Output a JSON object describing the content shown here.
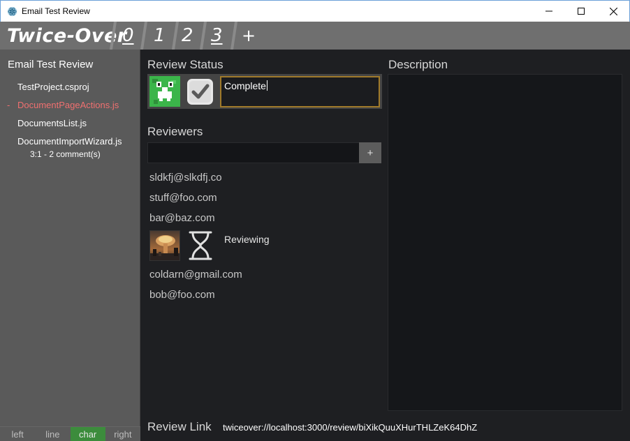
{
  "window": {
    "title": "Email Test Review"
  },
  "header": {
    "brand": "Twice-Over",
    "tabs": [
      {
        "label": "0",
        "underlined": true
      },
      {
        "label": "1",
        "underlined": false
      },
      {
        "label": "2",
        "underlined": false
      },
      {
        "label": "3",
        "underlined": true
      }
    ],
    "add_label": "+"
  },
  "sidebar": {
    "title": "Email Test Review",
    "files": [
      {
        "name": "TestProject.csproj",
        "active": false
      },
      {
        "name": "DocumentPageActions.js",
        "active": true,
        "marker": "-"
      },
      {
        "name": "DocumentsList.js",
        "active": false
      },
      {
        "name": "DocumentImportWizard.js",
        "active": false,
        "sub": "3:1 - 2 comment(s)"
      }
    ],
    "modes": [
      {
        "label": "left",
        "active": false
      },
      {
        "label": "line",
        "active": false
      },
      {
        "label": "char",
        "active": true
      },
      {
        "label": "right",
        "active": false
      }
    ]
  },
  "review_status": {
    "title": "Review Status",
    "value": "Complete",
    "icons": [
      "creeper-icon",
      "checkmark-icon"
    ]
  },
  "reviewers": {
    "title": "Reviewers",
    "input_value": "",
    "add_label": "+",
    "list": [
      "sldkfj@slkdfj.co",
      "stuff@foo.com",
      "bar@baz.com"
    ],
    "current": {
      "status": "Reviewing",
      "icons": [
        "avatar-image",
        "hourglass-icon"
      ]
    },
    "list_after": [
      "coldarn@gmail.com",
      "bob@foo.com"
    ]
  },
  "description": {
    "title": "Description",
    "value": ""
  },
  "review_link": {
    "label": "Review Link",
    "value": "twiceover://localhost:3000/review/biXikQuuXHurTHLZeK64DhZ"
  },
  "colors": {
    "header_bg": "#6f6f6f",
    "sidebar_bg": "#5a5a5a",
    "main_bg": "#1e1f22",
    "active_file": "#f07070",
    "active_mode": "#3c8c3c",
    "status_border": "#a07a2a",
    "creeper": "#3bb54a"
  }
}
